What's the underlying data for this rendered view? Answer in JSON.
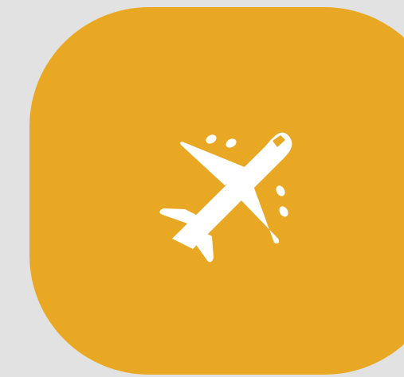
{
  "app_icon": {
    "icon": "airplane-icon",
    "colors": {
      "background": "#e2e2e2",
      "tile": "#e8a823",
      "glyph": "#ffffff"
    }
  }
}
